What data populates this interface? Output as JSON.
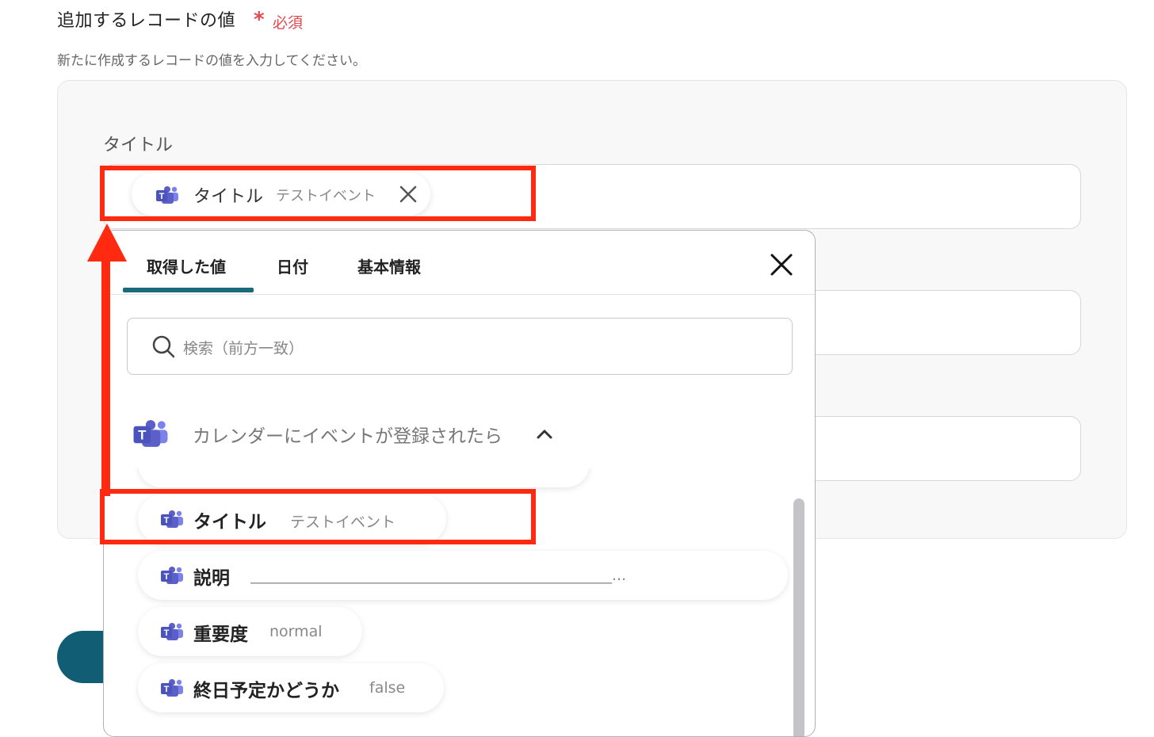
{
  "section": {
    "title": "追加するレコードの値",
    "required_mark": "*",
    "required_label": "必須",
    "description": "新たに作成するレコードの値を入力してください。"
  },
  "field": {
    "label": "タイトル",
    "chip": {
      "name": "タイトル",
      "value": "テストイベント"
    }
  },
  "popup": {
    "tabs": [
      {
        "label": "取得した値",
        "active": true
      },
      {
        "label": "日付",
        "active": false
      },
      {
        "label": "基本情報",
        "active": false
      }
    ],
    "search_placeholder": "検索（前方一致）",
    "group": {
      "label": "カレンダーにイベントが登録されたら",
      "expanded": true
    },
    "items": [
      {
        "name": "タイトル",
        "value": "テストイベント"
      },
      {
        "name": "説明",
        "value": "________________________________________________..."
      },
      {
        "name": "重要度",
        "value": "normal"
      },
      {
        "name": "終日予定かどうか",
        "value": "false"
      }
    ]
  },
  "colors": {
    "highlight": "#ff2a10",
    "accent": "#1a6b7a",
    "required": "#e5484d",
    "teams": "#5b5fc7"
  }
}
